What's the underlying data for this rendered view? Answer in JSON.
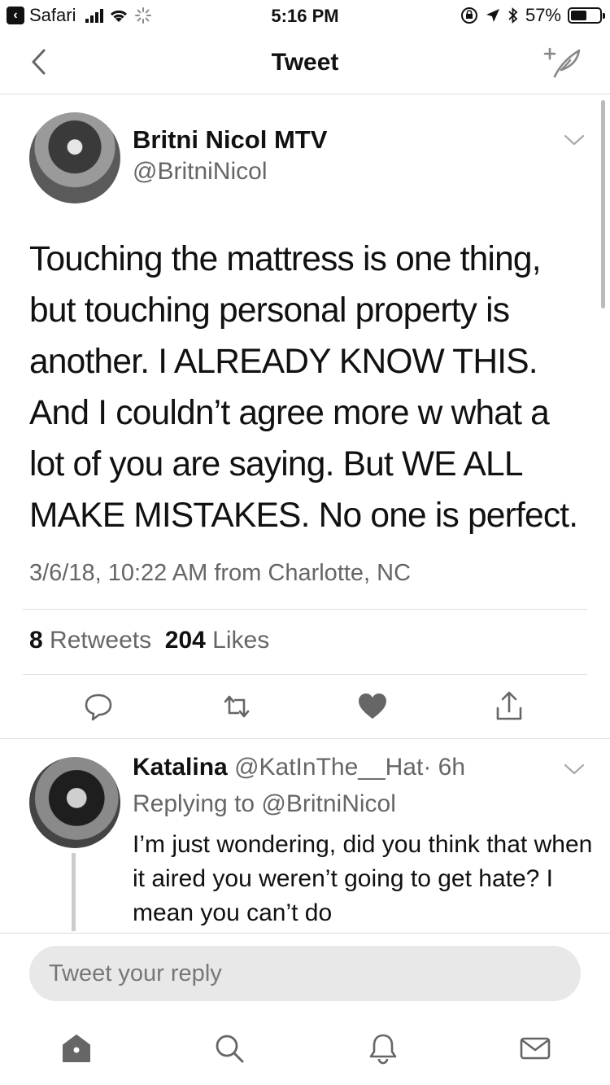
{
  "status_bar": {
    "back_app": "Safari",
    "time": "5:16 PM",
    "battery": "57%",
    "battery_level": 0.57
  },
  "nav": {
    "title": "Tweet",
    "icons": [
      "chevron-left-icon",
      "compose-tweet-icon"
    ]
  },
  "tweet": {
    "author_name": "Britni Nicol MTV",
    "author_handle": "@BritniNicol",
    "text": "Touching the mattress is one thing, but touching personal property is another. I ALREADY KNOW THIS. And I couldn’t agree more w what a lot of you are saying. But WE ALL MAKE MISTAKES. No one is perfect.",
    "meta": "3/6/18, 10:22 AM from Charlotte, NC",
    "retweets_count": "8",
    "retweets_label": "Retweets",
    "likes_count": "204",
    "likes_label": "Likes",
    "actions": [
      "reply-icon",
      "retweet-icon",
      "like-icon",
      "share-icon"
    ]
  },
  "reply": {
    "author_name": "Katalina",
    "author_handle": "@KatInThe__Hat",
    "time": "· 6h",
    "replying_to": "Replying to @BritniNicol",
    "text": "I’m just wondering, did you think that when it aired you weren’t going to get hate? I mean you can’t do"
  },
  "composer": {
    "placeholder": "Tweet your reply",
    "value": ""
  },
  "tabbar": {
    "tabs": [
      "home-icon",
      "search-icon",
      "notifications-icon",
      "messages-icon"
    ]
  },
  "colors": {
    "text": "#111111",
    "secondary": "#666666",
    "divider": "#dddddd",
    "input_bg": "#e8e8e8"
  }
}
